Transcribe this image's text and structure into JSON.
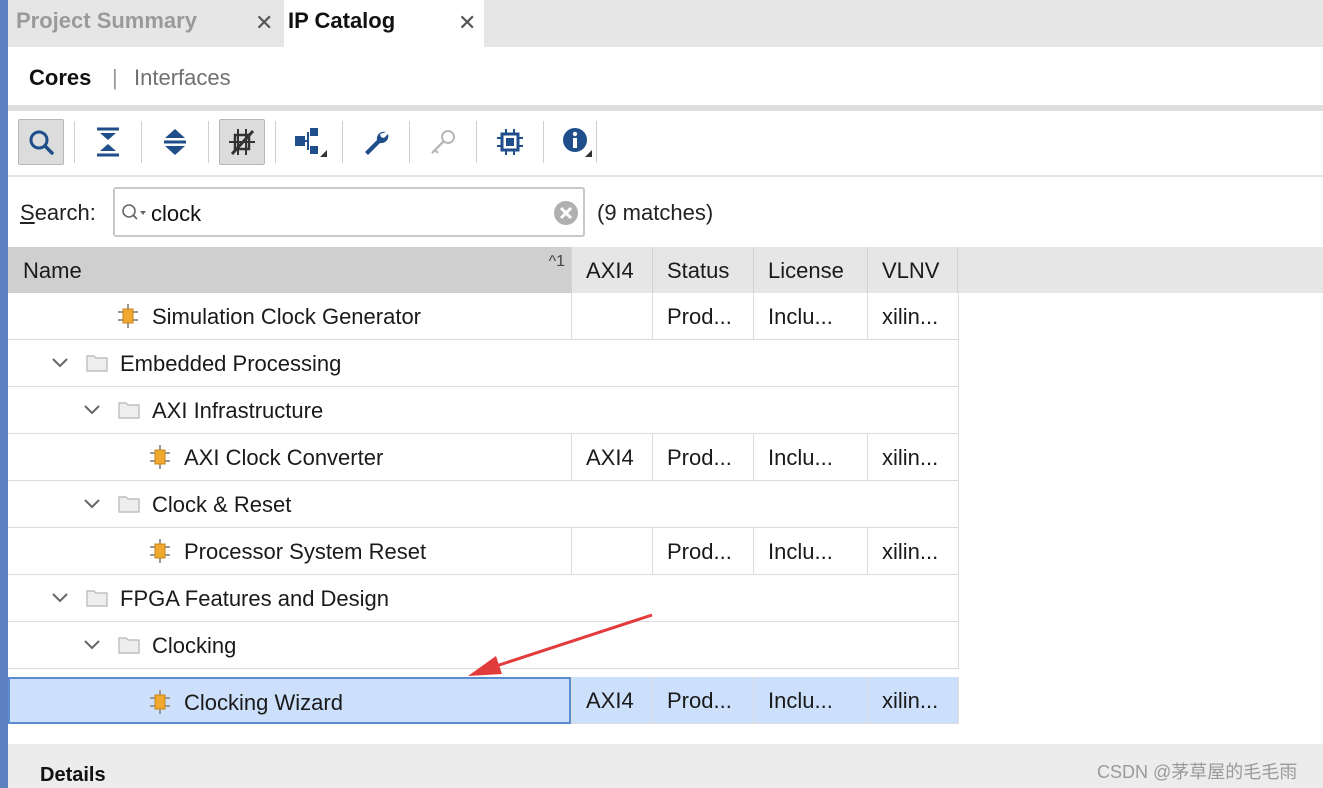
{
  "tabs": [
    {
      "label": "Project Summary",
      "active": false
    },
    {
      "label": "IP Catalog",
      "active": true
    }
  ],
  "close_glyph": "✕",
  "subtabs": {
    "cores": "Cores",
    "separator": "|",
    "interfaces": "Interfaces"
  },
  "toolbar": {
    "buttons": [
      "search-icon",
      "collapse-all-icon",
      "expand-all-icon",
      "show-hide-incompatible-icon",
      "hierarchy-icon",
      "wrench-icon",
      "key-icon",
      "chip-icon",
      "info-icon"
    ]
  },
  "search": {
    "label_underlined": "S",
    "label_rest": "earch:",
    "value": "clock",
    "matches": "(9 matches)"
  },
  "table": {
    "columns": {
      "name": "Name",
      "axi4": "AXI4",
      "status": "Status",
      "license": "License",
      "vlnv": "VLNV"
    },
    "sort_indicator": "^1",
    "rows": [
      {
        "name": "Simulation Clock Generator",
        "kind": "ip",
        "axi4": "",
        "status": "Prod...",
        "license": "Inclu...",
        "vlnv": "xilin..."
      },
      {
        "name": "Embedded Processing",
        "kind": "folder",
        "axi4": "",
        "status": "",
        "license": "",
        "vlnv": ""
      },
      {
        "name": "AXI Infrastructure",
        "kind": "folder",
        "axi4": "",
        "status": "",
        "license": "",
        "vlnv": ""
      },
      {
        "name": "AXI Clock Converter",
        "kind": "ip",
        "axi4": "AXI4",
        "status": "Prod...",
        "license": "Inclu...",
        "vlnv": "xilin..."
      },
      {
        "name": "Clock & Reset",
        "kind": "folder",
        "axi4": "",
        "status": "",
        "license": "",
        "vlnv": ""
      },
      {
        "name": "Processor System Reset",
        "kind": "ip",
        "axi4": "",
        "status": "Prod...",
        "license": "Inclu...",
        "vlnv": "xilin..."
      },
      {
        "name": "FPGA Features and Design",
        "kind": "folder",
        "axi4": "",
        "status": "",
        "license": "",
        "vlnv": ""
      },
      {
        "name": "Clocking",
        "kind": "folder",
        "axi4": "",
        "status": "",
        "license": "",
        "vlnv": ""
      },
      {
        "name": "Clocking Wizard",
        "kind": "ip",
        "axi4": "AXI4",
        "status": "Prod...",
        "license": "Inclu...",
        "vlnv": "xilin...",
        "selected": true
      }
    ]
  },
  "details": {
    "label": "Details"
  },
  "watermark": "CSDN @茅草屋的毛毛雨",
  "colors": {
    "selection": "#cce0fc",
    "annotation_arrow": "#e23b3b",
    "ip_icon": "#f0a830"
  }
}
